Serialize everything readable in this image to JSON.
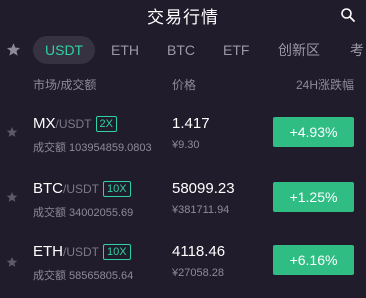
{
  "header": {
    "title": "交易行情"
  },
  "tabs": [
    "USDT",
    "ETH",
    "BTC",
    "ETF",
    "创新区",
    "考"
  ],
  "columns": {
    "market": "市场/成交额",
    "price": "价格",
    "change": "24H涨跌幅"
  },
  "colors": {
    "accent": "#2fd2a3",
    "up": "#2fbd83",
    "background": "#201c2b"
  },
  "rows": [
    {
      "base": "MX",
      "quote": "/USDT",
      "leverage": "2X",
      "volume": "成交额 103954859.0803",
      "price": "1.417",
      "cny": "¥9.30",
      "change": "+4.93%"
    },
    {
      "base": "BTC",
      "quote": "/USDT",
      "leverage": "10X",
      "volume": "成交额 34002055.69",
      "price": "58099.23",
      "cny": "¥381711.94",
      "change": "+1.25%"
    },
    {
      "base": "ETH",
      "quote": "/USDT",
      "leverage": "10X",
      "volume": "成交额 58565805.64",
      "price": "4118.46",
      "cny": "¥27058.28",
      "change": "+6.16%"
    }
  ]
}
